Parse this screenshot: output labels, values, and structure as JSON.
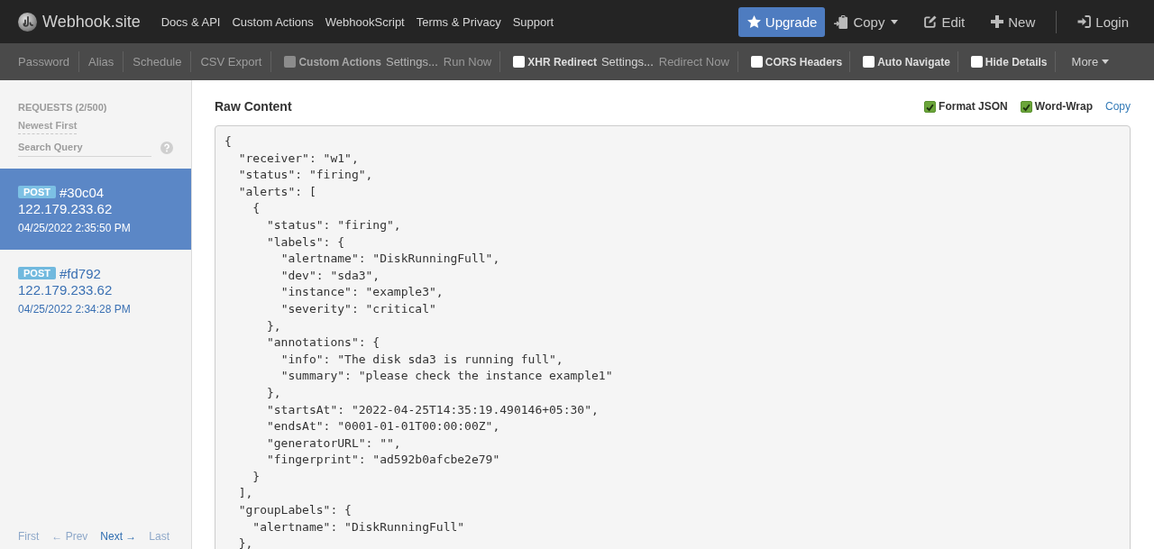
{
  "navbar": {
    "brand": "Webhook.site",
    "links": [
      "Docs & API",
      "Custom Actions",
      "WebhookScript",
      "Terms & Privacy",
      "Support"
    ],
    "actions": [
      {
        "kind": "primary",
        "label": "Upgrade"
      },
      {
        "kind": "dropdown",
        "label": "Copy"
      },
      {
        "kind": "plain",
        "label": "Edit"
      },
      {
        "kind": "plain",
        "label": "New"
      },
      {
        "kind": "separated",
        "label": "Login"
      }
    ]
  },
  "toolbar": [
    {
      "kind": "link",
      "label": "Password",
      "disabled": true
    },
    {
      "kind": "link",
      "label": "Alias",
      "disabled": true
    },
    {
      "kind": "link",
      "label": "Schedule",
      "disabled": true
    },
    {
      "kind": "link",
      "label": "CSV Export",
      "disabled": true
    },
    {
      "kind": "toggle",
      "label": "Custom Actions",
      "checked": false,
      "disabled": true,
      "actions": [
        {
          "label": "Settings...",
          "disabled": false
        },
        {
          "label": "Run Now",
          "disabled": true
        }
      ]
    },
    {
      "kind": "toggle",
      "label": "XHR Redirect",
      "checked": false,
      "disabled": false,
      "actions": [
        {
          "label": "Settings...",
          "disabled": false
        },
        {
          "label": "Redirect Now",
          "disabled": true
        }
      ]
    },
    {
      "kind": "toggle",
      "label": "CORS Headers",
      "checked": false,
      "disabled": false
    },
    {
      "kind": "toggle",
      "label": "Auto Navigate",
      "checked": false,
      "disabled": false
    },
    {
      "kind": "toggle",
      "label": "Hide Details",
      "checked": false,
      "disabled": false
    },
    {
      "kind": "menu",
      "label": "More",
      "disabled": false
    }
  ],
  "sidebar": {
    "title": "REQUESTS (2/500)",
    "sort": "Newest First",
    "search": {
      "placeholder": "Search Query"
    },
    "requests": [
      {
        "method": "POST",
        "id": "#30c04",
        "ip": "122.179.233.62",
        "time": "04/25/2022 2:35:50 PM",
        "selected": true
      },
      {
        "method": "POST",
        "id": "#fd792",
        "ip": "122.179.233.62",
        "time": "04/25/2022 2:34:28 PM",
        "selected": false
      }
    ],
    "pagination": [
      {
        "label": "First",
        "disabled": true
      },
      {
        "label": "← Prev",
        "disabled": true
      },
      {
        "label": "Next →",
        "disabled": false
      },
      {
        "label": "Last",
        "disabled": true
      }
    ]
  },
  "raw_content": {
    "title": "Raw Content",
    "options": [
      {
        "label": "Format JSON",
        "checked": true
      },
      {
        "label": "Word-Wrap",
        "checked": true
      }
    ],
    "copy_link": "Copy",
    "code": "{\n  \"receiver\": \"w1\",\n  \"status\": \"firing\",\n  \"alerts\": [\n    {\n      \"status\": \"firing\",\n      \"labels\": {\n        \"alertname\": \"DiskRunningFull\",\n        \"dev\": \"sda3\",\n        \"instance\": \"example3\",\n        \"severity\": \"critical\"\n      },\n      \"annotations\": {\n        \"info\": \"The disk sda3 is running full\",\n        \"summary\": \"please check the instance example1\"\n      },\n      \"startsAt\": \"2022-04-25T14:35:19.490146+05:30\",\n      \"endsAt\": \"0001-01-01T00:00:00Z\",\n      \"generatorURL\": \"\",\n      \"fingerprint\": \"ad592b0afcbe2e79\"\n    }\n  ],\n  \"groupLabels\": {\n    \"alertname\": \"DiskRunningFull\"\n  },"
  }
}
